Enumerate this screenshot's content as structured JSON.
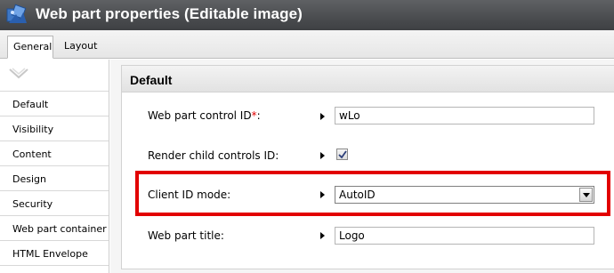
{
  "window": {
    "title": "Web part properties (Editable image)",
    "icon": "web-part-icon"
  },
  "tabs": [
    {
      "label": "General",
      "active": true
    },
    {
      "label": "Layout",
      "active": false
    }
  ],
  "sidebar": {
    "collapse_icon": "chevron-down-icon",
    "items": [
      {
        "label": "Default"
      },
      {
        "label": "Visibility"
      },
      {
        "label": "Content"
      },
      {
        "label": "Design"
      },
      {
        "label": "Security"
      },
      {
        "label": "Web part container"
      },
      {
        "label": "HTML Envelope"
      }
    ]
  },
  "panel": {
    "title": "Default",
    "fields": {
      "control_id": {
        "label": "Web part control ID",
        "required_mark": "*",
        "suffix": ":",
        "value": "wLo"
      },
      "render_child": {
        "label": "Render child controls ID:",
        "checked": true
      },
      "client_id_mode": {
        "label": "Client ID mode:",
        "value": "AutoID"
      },
      "title": {
        "label": "Web part title:",
        "value": "Logo"
      }
    }
  },
  "colors": {
    "highlight": "#e20000",
    "titlebar": "#4a4c4f"
  }
}
